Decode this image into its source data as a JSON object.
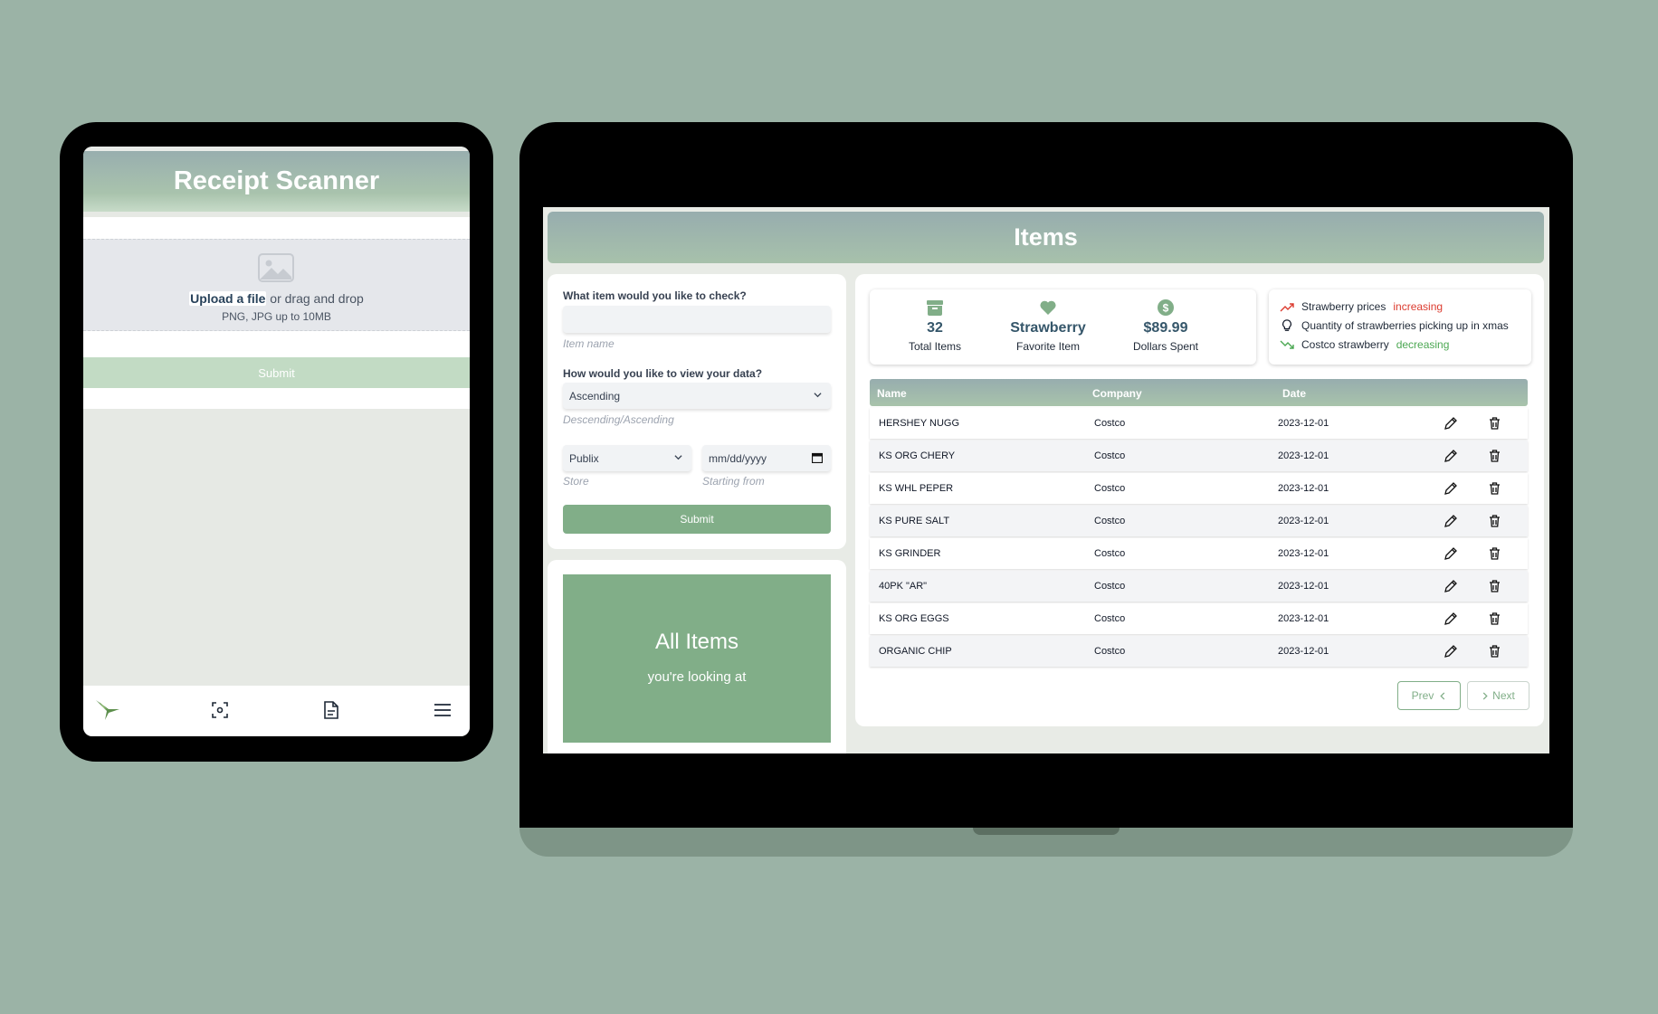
{
  "tablet": {
    "title": "Receipt Scanner",
    "upload_link": "Upload a file",
    "upload_rest": " or drag and drop",
    "upload_hint": "PNG, JPG up to 10MB",
    "submit_label": "Submit",
    "nav": [
      "logo-icon",
      "scan-icon",
      "document-icon",
      "menu-icon"
    ]
  },
  "laptop": {
    "title": "Items",
    "form": {
      "q1_label": "What item would you like to check?",
      "item_value": "",
      "item_hint": "Item name",
      "q2_label": "How would you like to view your data?",
      "order_value": "Ascending",
      "order_hint": "Descending/Ascending",
      "store_value": "Publix",
      "store_hint": "Store",
      "date_value": "mm/dd/yyyy",
      "date_hint": "Starting from",
      "submit_label": "Submit"
    },
    "banner": {
      "title": "All Items",
      "subtitle": "you're looking at"
    },
    "stats": [
      {
        "icon": "archive-icon",
        "value": "32",
        "label": "Total Items"
      },
      {
        "icon": "heart-icon",
        "value": "Strawberry",
        "label": "Favorite Item"
      },
      {
        "icon": "dollar-icon",
        "value": "$89.99",
        "label": "Dollars Spent"
      }
    ],
    "trends": [
      {
        "icon": "trend-up-icon",
        "text": "Strawberry prices",
        "status": "increasing"
      },
      {
        "icon": "lightbulb-icon",
        "text": "Quantity of strawberries picking up in xmas",
        "status": ""
      },
      {
        "icon": "trend-down-icon",
        "text": "Costco strawberry",
        "status": "decreasing"
      }
    ],
    "table": {
      "headers": [
        "Name",
        "Company",
        "Date"
      ],
      "rows": [
        {
          "name": "HERSHEY NUGG",
          "company": "Costco",
          "date": "2023-12-01"
        },
        {
          "name": "KS ORG CHERY",
          "company": "Costco",
          "date": "2023-12-01"
        },
        {
          "name": "KS WHL PEPER",
          "company": "Costco",
          "date": "2023-12-01"
        },
        {
          "name": "KS PURE SALT",
          "company": "Costco",
          "date": "2023-12-01"
        },
        {
          "name": "KS GRINDER",
          "company": "Costco",
          "date": "2023-12-01"
        },
        {
          "name": "40PK \"AR\"",
          "company": "Costco",
          "date": "2023-12-01"
        },
        {
          "name": "KS ORG EGGS",
          "company": "Costco",
          "date": "2023-12-01"
        },
        {
          "name": "ORGANIC CHIP",
          "company": "Costco",
          "date": "2023-12-01"
        }
      ]
    },
    "pagination": {
      "prev": "Prev",
      "next": "Next"
    }
  },
  "colors": {
    "accent": "#81ae88",
    "background": "#9bb3a6",
    "header_gradient": "#97adae",
    "increase": "#dc3b2f",
    "decrease": "#4ca853"
  }
}
